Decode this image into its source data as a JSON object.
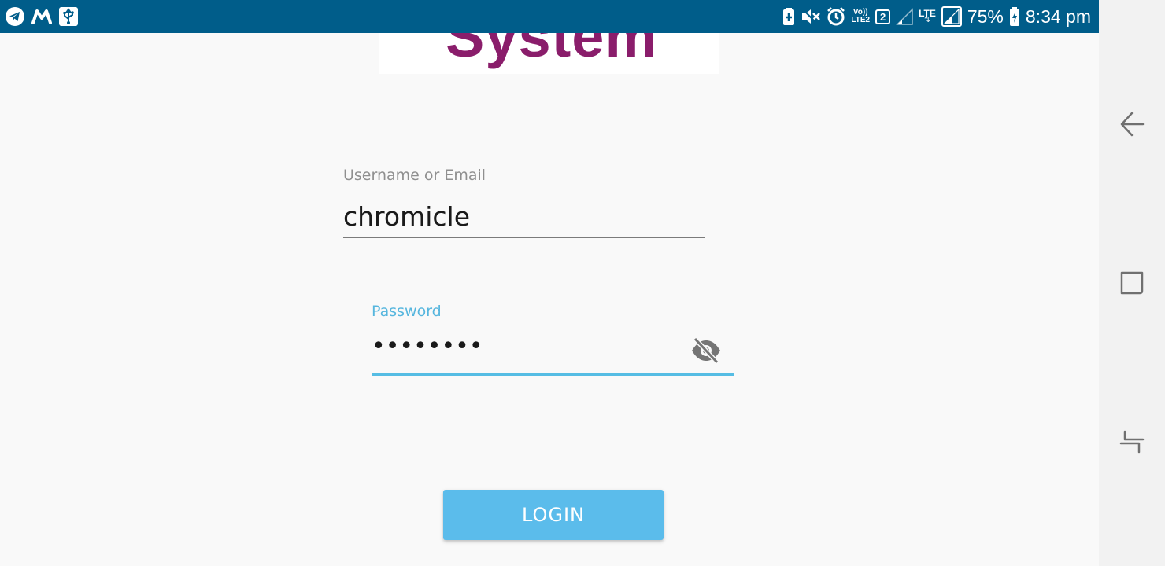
{
  "status_bar": {
    "left_icons": [
      "telegram-icon",
      "m-app-icon",
      "usb-icon"
    ],
    "volte_top": "Vo))",
    "volte_bottom": "LTE2",
    "sim_number": "2",
    "lte_label": "LTE",
    "battery_percent": "75%",
    "time": "8:34 pm",
    "background_color": "#005d8a"
  },
  "logo": {
    "text": "System",
    "color": "#8a1d6b"
  },
  "form": {
    "username": {
      "label": "Username or Email",
      "value": "chromicle"
    },
    "password": {
      "label": "Password",
      "value": "••••••••",
      "toggle_icon": "eye-off-icon",
      "accent_color": "#56bde4"
    },
    "login_label": "LOGIN",
    "login_color": "#5bbceb"
  },
  "nav_bar": {
    "icons": [
      "back-icon",
      "recents-icon",
      "overview-icon"
    ]
  }
}
